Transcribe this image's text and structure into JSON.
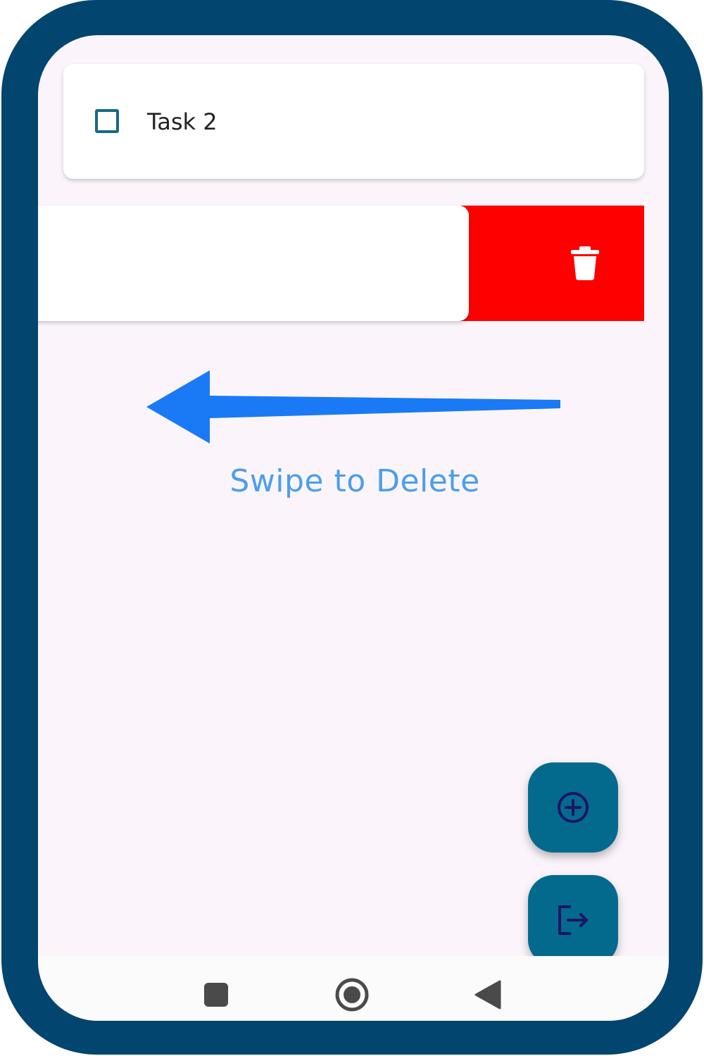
{
  "tasks": [
    {
      "label": "Task 2",
      "checked": false
    }
  ],
  "swipe_hint": {
    "label": "Swipe to Delete",
    "direction": "left"
  },
  "delete_action": {
    "icon": "trash-icon",
    "color": "#ff0000"
  },
  "fab": {
    "add_icon": "add-circle-icon",
    "logout_icon": "logout-icon",
    "color": "#046a8d"
  },
  "nav": {
    "recents_icon": "recents-icon",
    "home_icon": "home-icon",
    "back_icon": "back-icon"
  },
  "colors": {
    "frame": "#02456f",
    "background": "#fbf5fb",
    "checkbox": "#166a86",
    "hint_arrow": "#1a7af5",
    "hint_text": "#4a9ef0"
  }
}
